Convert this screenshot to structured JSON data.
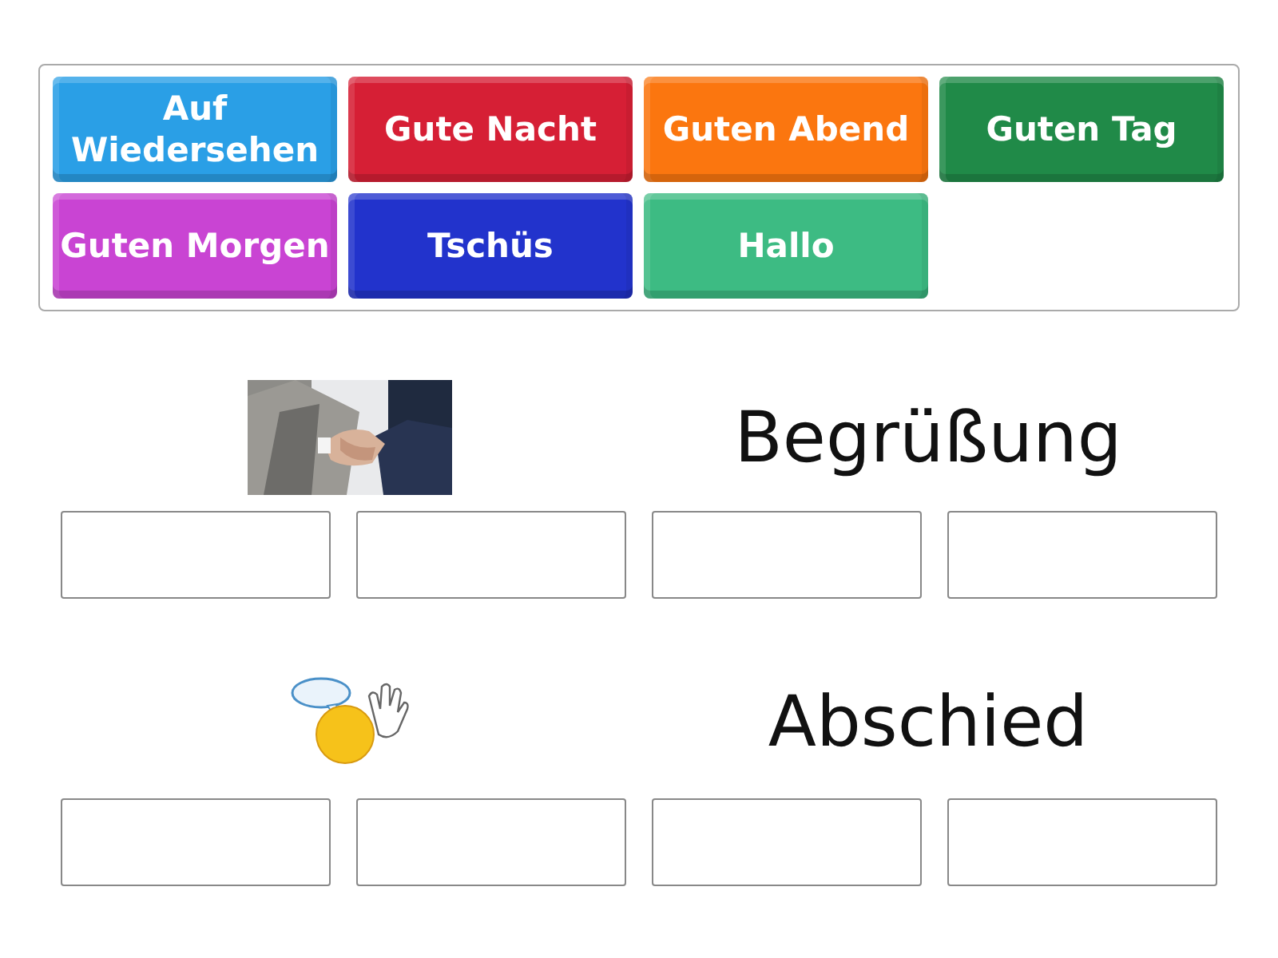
{
  "tiles": [
    {
      "label": "Auf Wiedersehen",
      "color": "#2a9fe6"
    },
    {
      "label": "Gute Nacht",
      "color": "#d61f35"
    },
    {
      "label": "Guten Abend",
      "color": "#fb760f"
    },
    {
      "label": "Guten Tag",
      "color": "#208a48"
    },
    {
      "label": "Guten Morgen",
      "color": "#c944d3"
    },
    {
      "label": "Tschüs",
      "color": "#2233cc"
    },
    {
      "label": "Hallo",
      "color": "#3dbb83"
    }
  ],
  "groups": [
    {
      "title": "Begrüßung"
    },
    {
      "image": {
        "kind": "clipart"
      },
      "title": "Abschied"
    }
  ]
}
